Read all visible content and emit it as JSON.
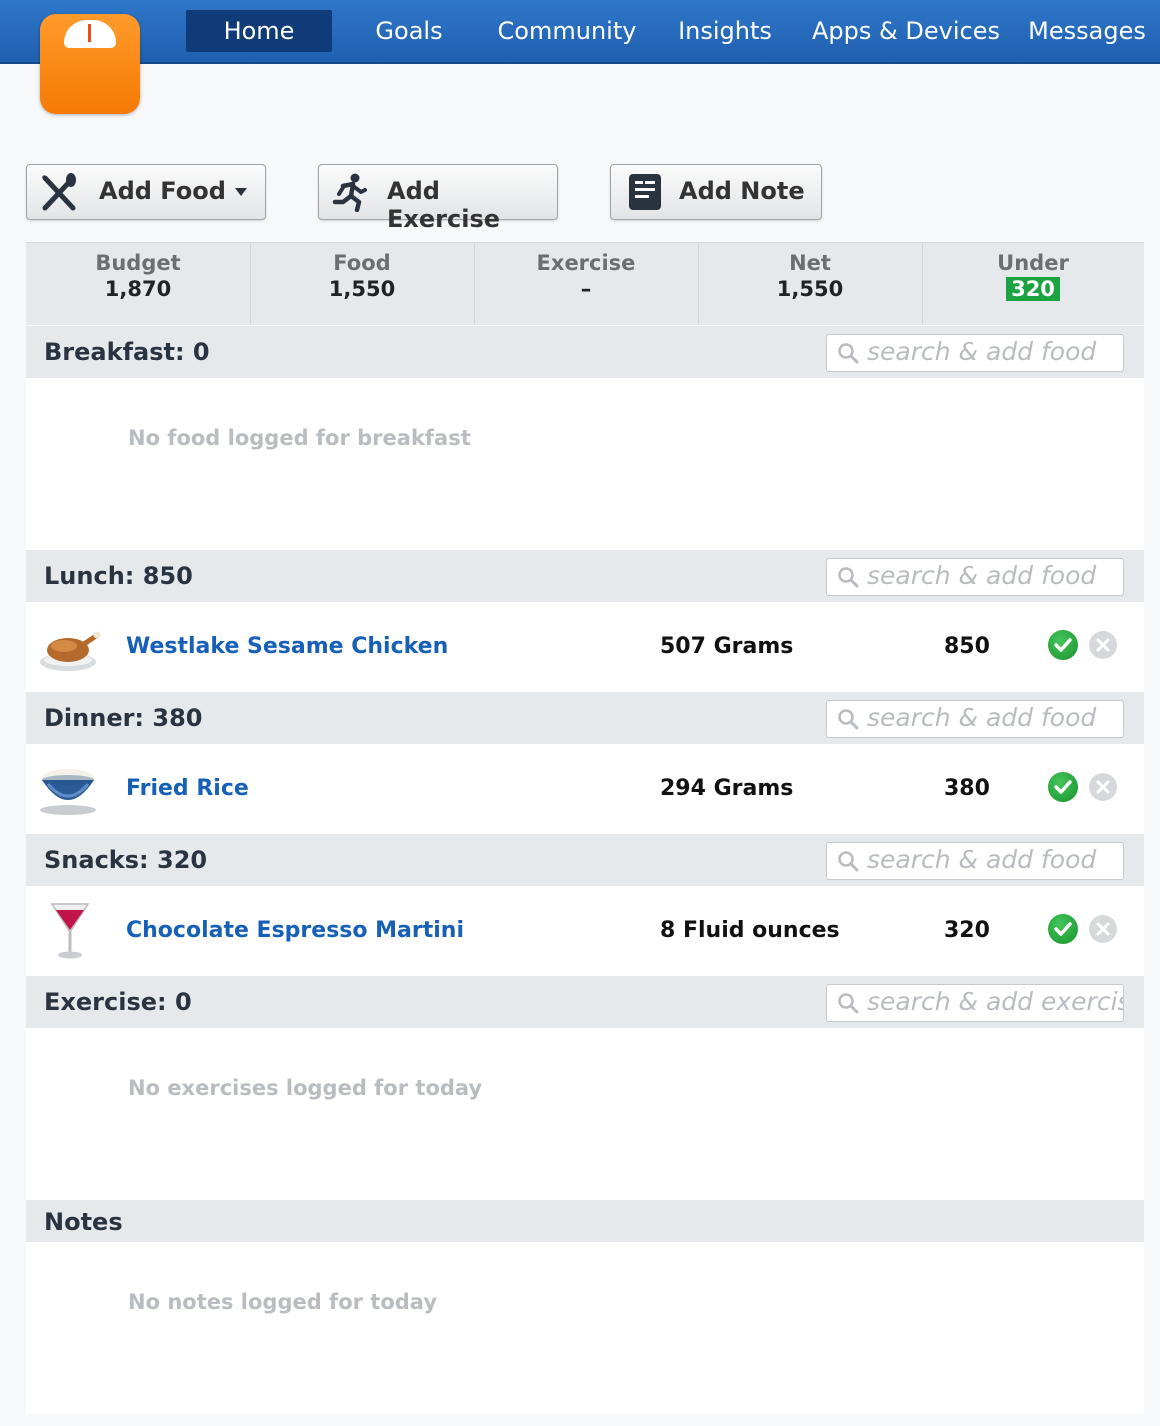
{
  "nav": {
    "items": [
      "Home",
      "Goals",
      "Community",
      "Insights",
      "Apps & Devices",
      "Messages"
    ],
    "active": "Home"
  },
  "actions": {
    "add_food": "Add Food",
    "add_exercise": "Add Exercise",
    "add_note": "Add Note"
  },
  "summary": {
    "budget_label": "Budget",
    "budget_value": "1,870",
    "food_label": "Food",
    "food_value": "1,550",
    "exercise_label": "Exercise",
    "exercise_value": "–",
    "net_label": "Net",
    "net_value": "1,550",
    "under_label": "Under",
    "under_value": "320"
  },
  "breakfast": {
    "title": "Breakfast: 0",
    "search_placeholder": "search & add food",
    "empty": "No food logged for breakfast"
  },
  "lunch": {
    "title": "Lunch: 850",
    "search_placeholder": "search & add food",
    "items": [
      {
        "name": "Westlake Sesame Chicken",
        "qty": "507 Grams",
        "cal": "850",
        "icon": "roast-chicken-icon"
      }
    ]
  },
  "dinner": {
    "title": "Dinner: 380",
    "search_placeholder": "search & add food",
    "items": [
      {
        "name": "Fried Rice",
        "qty": "294 Grams",
        "cal": "380",
        "icon": "rice-bowl-icon"
      }
    ]
  },
  "snacks": {
    "title": "Snacks: 320",
    "search_placeholder": "search & add food",
    "items": [
      {
        "name": "Chocolate Espresso Martini",
        "qty": "8 Fluid ounces",
        "cal": "320",
        "icon": "martini-glass-icon"
      }
    ]
  },
  "exercise": {
    "title": "Exercise: 0",
    "search_placeholder": "search & add exercise",
    "empty": "No exercises logged for today"
  },
  "notes": {
    "title": "Notes",
    "empty": "No notes logged for today"
  },
  "colors": {
    "nav_blue": "#2f77c9",
    "active_nav": "#0f3b78",
    "link_blue": "#1760b8",
    "under_green": "#1aa340",
    "logo_orange": "#f57a05"
  }
}
